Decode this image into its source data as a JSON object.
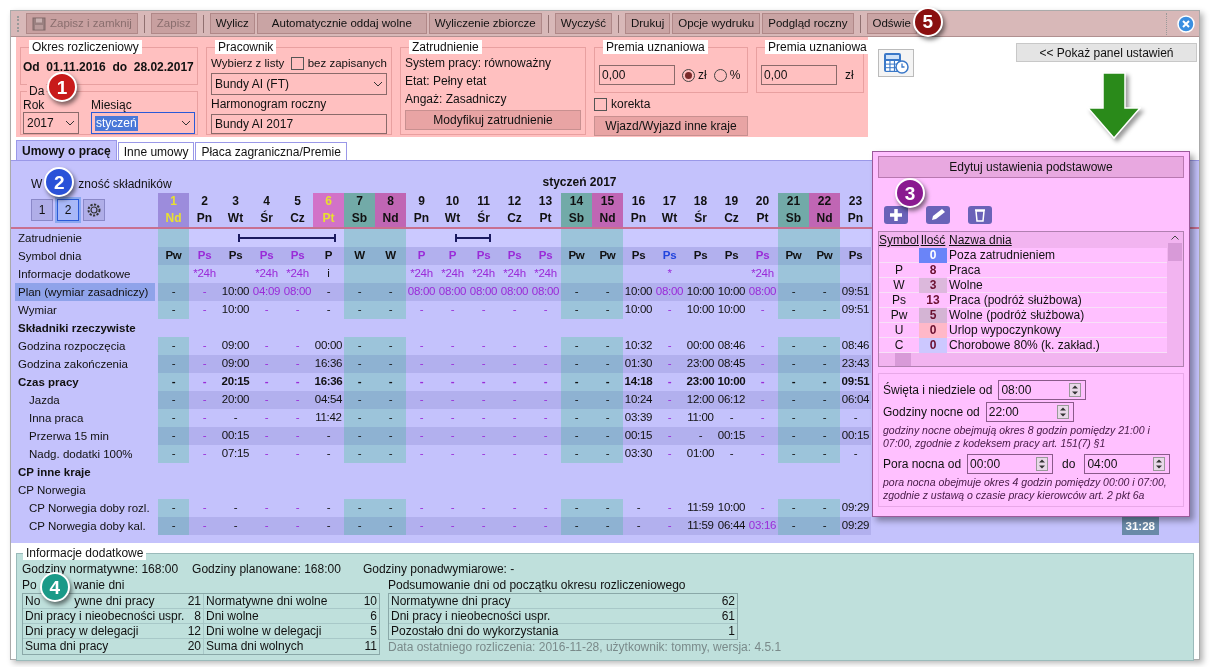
{
  "toolbar": {
    "buttons": [
      {
        "label": "Zapisz i zamknij",
        "disabled": true
      },
      {
        "label": "Zapisz",
        "disabled": true
      },
      {
        "label": "Wylicz",
        "disabled": false
      },
      {
        "label": "Automatycznie oddaj wolne",
        "disabled": false
      },
      {
        "label": "Wyliczenie zbiorcze",
        "disabled": false
      },
      {
        "label": "Wyczyść",
        "disabled": false
      },
      {
        "label": "Drukuj",
        "disabled": false
      },
      {
        "label": "Opcje wydruku",
        "disabled": false
      },
      {
        "label": "Podgląd roczny",
        "disabled": false
      },
      {
        "label": "Odświe",
        "disabled": false
      }
    ]
  },
  "period": {
    "title": "Okres rozliczeniowy",
    "range": "Od  01.11.2016  do  28.02.2017",
    "data_legend": "Da",
    "year_label": "Rok",
    "year": "2017",
    "month_label": "Miesiąc",
    "month": "styczeń"
  },
  "employee": {
    "title": "Pracownik",
    "pick_label": "Wybierz z listy",
    "unsaved": {
      "label": "bez zapisanych",
      "checked": false
    },
    "value": "Bundy AI (FT)",
    "schedule_label": "Harmonogram roczny",
    "schedule": "Bundy AI 2017"
  },
  "employment": {
    "title": "Zatrudnienie",
    "lines": [
      "System pracy: równoważny",
      "Etat: Pełny etat",
      "Angaż: Zasadniczy"
    ],
    "button": "Modyfikuj zatrudnienie"
  },
  "bonus": {
    "title": "Premia uznaniowa",
    "value": "0,00",
    "units": [
      {
        "label": "zł",
        "selected": true
      },
      {
        "label": "%",
        "selected": false
      }
    ],
    "correction": {
      "label": "korekta",
      "checked": false
    },
    "button": "Wjazd/Wyjazd inne kraje"
  },
  "bonus2": {
    "title": "Premia uznaniowa",
    "value": "0,00",
    "unit": "zł"
  },
  "show_panel_button": "<< Pokaż panel ustawień",
  "tabs": [
    {
      "label": "Umowy o pracę",
      "selected": true
    },
    {
      "label": "Inne umowy",
      "selected": false
    },
    {
      "label": "Płaca zagraniczna/Premie",
      "selected": false
    }
  ],
  "grid": {
    "visibility_label_parts": [
      "W",
      "zność składników"
    ],
    "visibility_buttons": [
      {
        "label": "1",
        "selected": false
      },
      {
        "label": "2",
        "selected": true
      }
    ],
    "month_title": "styczeń 2017",
    "days": [
      {
        "day": "1",
        "dow": "Nd",
        "kind": "holiday_sunday",
        "planned": false,
        "trip": false
      },
      {
        "day": "2",
        "dow": "Pn",
        "kind": "workday",
        "planned": true,
        "trip": false,
        "info": "*24h"
      },
      {
        "day": "3",
        "dow": "Wt",
        "kind": "workday",
        "planned": false,
        "trip": true
      },
      {
        "day": "4",
        "dow": "Śr",
        "kind": "workday",
        "planned": true,
        "trip": true,
        "info": "*24h"
      },
      {
        "day": "5",
        "dow": "Cz",
        "kind": "workday",
        "planned": true,
        "trip": true,
        "info": "*24h"
      },
      {
        "day": "6",
        "dow": "Pt",
        "kind": "holiday",
        "planned": false,
        "trip": true,
        "info": "i"
      },
      {
        "day": "7",
        "dow": "Sb",
        "kind": "saturday",
        "planned": false,
        "trip": false
      },
      {
        "day": "8",
        "dow": "Nd",
        "kind": "sunday",
        "planned": false,
        "trip": false
      },
      {
        "day": "9",
        "dow": "Pn",
        "kind": "workday",
        "planned": true,
        "trip": false,
        "info": "*24h"
      },
      {
        "day": "10",
        "dow": "Wt",
        "kind": "workday",
        "planned": true,
        "trip": true,
        "info": "*24h"
      },
      {
        "day": "11",
        "dow": "Śr",
        "kind": "workday",
        "planned": true,
        "trip": true,
        "info": "*24h"
      },
      {
        "day": "12",
        "dow": "Cz",
        "kind": "workday",
        "planned": true,
        "trip": false,
        "info": "*24h"
      },
      {
        "day": "13",
        "dow": "Pt",
        "kind": "workday",
        "planned": true,
        "trip": false,
        "info": "*24h"
      },
      {
        "day": "14",
        "dow": "Sb",
        "kind": "saturday",
        "planned": false,
        "trip": false
      },
      {
        "day": "15",
        "dow": "Nd",
        "kind": "sunday",
        "planned": false,
        "trip": false
      },
      {
        "day": "16",
        "dow": "Pn",
        "kind": "workday",
        "planned": false,
        "trip": false
      },
      {
        "day": "17",
        "dow": "Wt",
        "kind": "workday",
        "planned": true,
        "trip": false,
        "info": "*"
      },
      {
        "day": "18",
        "dow": "Śr",
        "kind": "workday",
        "planned": false,
        "trip": false
      },
      {
        "day": "19",
        "dow": "Cz",
        "kind": "workday",
        "planned": false,
        "trip": false
      },
      {
        "day": "20",
        "dow": "Pt",
        "kind": "workday",
        "planned": true,
        "trip": false,
        "info": "*24h"
      },
      {
        "day": "21",
        "dow": "Sb",
        "kind": "saturday",
        "planned": false,
        "trip": false
      },
      {
        "day": "22",
        "dow": "Nd",
        "kind": "sunday",
        "planned": false,
        "trip": false
      },
      {
        "day": "23",
        "dow": "Pn",
        "kind": "workday",
        "planned": false,
        "trip": false
      }
    ],
    "rows": [
      {
        "label": "Zatrudnienie",
        "kind": "trips",
        "selected": false
      },
      {
        "label": "Symbol dnia",
        "kind": "symbol",
        "selected": false,
        "values": [
          {
            "text": "Pw",
            "color": "#111111"
          },
          {
            "text": "Ps",
            "color": "#9a2bd8"
          },
          {
            "text": "Ps",
            "color": "#111111"
          },
          {
            "text": "Ps",
            "color": "#9a2bd8"
          },
          {
            "text": "Ps",
            "color": "#9a2bd8"
          },
          {
            "text": "P",
            "color": "#111111"
          },
          {
            "text": "W",
            "color": "#111111"
          },
          {
            "text": "W",
            "color": "#111111"
          },
          {
            "text": "P",
            "color": "#9a2bd8"
          },
          {
            "text": "P",
            "color": "#9a2bd8"
          },
          {
            "text": "Ps",
            "color": "#9a2bd8"
          },
          {
            "text": "Ps",
            "color": "#9a2bd8"
          },
          {
            "text": "Ps",
            "color": "#9a2bd8"
          },
          {
            "text": "Pw",
            "color": "#111111"
          },
          {
            "text": "Pw",
            "color": "#111111"
          },
          {
            "text": "Ps",
            "color": "#111111"
          },
          {
            "text": "Ps",
            "color": "#2244dd"
          },
          {
            "text": "Ps",
            "color": "#111111"
          },
          {
            "text": "Ps",
            "color": "#111111"
          },
          {
            "text": "Ps",
            "color": "#9a2bd8"
          },
          {
            "text": "Pw",
            "color": "#111111"
          },
          {
            "text": "Pw",
            "color": "#111111"
          },
          {
            "text": "Ps",
            "color": "#111111"
          }
        ]
      },
      {
        "label": "Informacje dodatkowe",
        "kind": "info",
        "selected": false
      },
      {
        "label": "Plan (wymiar zasadniczy)",
        "kind": "values",
        "selected": true,
        "values": [
          "-",
          "-",
          "10:00",
          "04:09",
          "08:00",
          "-",
          "-",
          "-",
          "08:00",
          "08:00",
          "08:00",
          "08:00",
          "08:00",
          "-",
          "-",
          "10:00",
          "08:00",
          "10:00",
          "10:00",
          "08:00",
          "-",
          "-",
          "09:51"
        ]
      },
      {
        "label": "Wymiar",
        "kind": "values",
        "selected": false,
        "values": [
          "-",
          "-",
          "10:00",
          "-",
          "-",
          "-",
          "-",
          "-",
          "-",
          "-",
          "-",
          "-",
          "-",
          "-",
          "-",
          "10:00",
          "-",
          "10:00",
          "10:00",
          "-",
          "-",
          "-",
          "09:51"
        ]
      },
      {
        "label": "Składniki rzeczywiste",
        "kind": "section",
        "bold": true,
        "selected": false
      },
      {
        "label": "Godzina rozpoczęcia",
        "kind": "values",
        "selected": false,
        "values": [
          "-",
          "-",
          "09:00",
          "-",
          "-",
          "00:00",
          "-",
          "-",
          "-",
          "-",
          "-",
          "-",
          "-",
          "-",
          "-",
          "10:32",
          "-",
          "00:00",
          "08:46",
          "-",
          "-",
          "-",
          "08:46"
        ]
      },
      {
        "label": "Godzina zakończenia",
        "kind": "values",
        "selected": false,
        "values": [
          "-",
          "-",
          "09:00",
          "-",
          "-",
          "16:36",
          "-",
          "-",
          "-",
          "-",
          "-",
          "-",
          "-",
          "-",
          "-",
          "01:30",
          "-",
          "23:00",
          "08:45",
          "-",
          "-",
          "-",
          "23:43"
        ]
      },
      {
        "label": "Czas pracy",
        "kind": "values",
        "bold": true,
        "selected": false,
        "values": [
          "-",
          "-",
          "20:15",
          "-",
          "-",
          "16:36",
          "-",
          "-",
          "-",
          "-",
          "-",
          "-",
          "-",
          "-",
          "-",
          "14:18",
          "-",
          "23:00",
          "10:00",
          "-",
          "-",
          "-",
          "09:51"
        ],
        "children": [
          {
            "label": "Jazda",
            "kind": "values",
            "selected": false,
            "values": [
              "-",
              "-",
              "20:00",
              "-",
              "-",
              "04:54",
              "-",
              "-",
              "-",
              "-",
              "-",
              "-",
              "-",
              "-",
              "-",
              "10:24",
              "-",
              "12:00",
              "06:12",
              "-",
              "-",
              "-",
              "06:04"
            ]
          },
          {
            "label": "Inna praca",
            "kind": "values",
            "selected": false,
            "values": [
              "-",
              "-",
              "-",
              "-",
              "-",
              "11:42",
              "-",
              "-",
              "-",
              "-",
              "-",
              "-",
              "-",
              "-",
              "-",
              "03:39",
              "-",
              "11:00",
              "-",
              "-",
              "-",
              "-",
              "-"
            ]
          },
          {
            "label": "Przerwa 15 min",
            "kind": "values",
            "selected": false,
            "values": [
              "-",
              "-",
              "00:15",
              "-",
              "-",
              "-",
              "-",
              "-",
              "-",
              "-",
              "-",
              "-",
              "-",
              "-",
              "-",
              "00:15",
              "-",
              "-",
              "00:15",
              "-",
              "-",
              "-",
              "00:15"
            ]
          },
          {
            "label": "Nadg. dodatki 100%",
            "kind": "values",
            "selected": false,
            "values": [
              "-",
              "-",
              "07:15",
              "-",
              "-",
              "-",
              "-",
              "-",
              "-",
              "-",
              "-",
              "-",
              "-",
              "-",
              "-",
              "03:30",
              "-",
              "01:00",
              "-",
              "-",
              "-",
              "-",
              "-"
            ]
          }
        ]
      },
      {
        "label": "CP inne kraje",
        "kind": "section",
        "bold": true,
        "selected": false
      },
      {
        "label": "CP Norwegia",
        "kind": "section",
        "bold": false,
        "selected": false,
        "children": [
          {
            "label": "CP Norwegia doby rozl.",
            "kind": "values",
            "selected": false,
            "values": [
              "-",
              "-",
              "-",
              "-",
              "-",
              "-",
              "-",
              "-",
              "-",
              "-",
              "-",
              "-",
              "-",
              "-",
              "-",
              "-",
              "-",
              "11:59",
              "10:00",
              "-",
              "-",
              "-",
              "09:29"
            ]
          },
          {
            "label": "CP Norwegia doby kal.",
            "kind": "values",
            "selected": false,
            "total": "31:28",
            "values": [
              "-",
              "-",
              "-",
              "-",
              "-",
              "-",
              "-",
              "-",
              "-",
              "-",
              "-",
              "-",
              "-",
              "-",
              "-",
              "-",
              "-",
              "11:59",
              "06:44",
              "03:16",
              "-",
              "-",
              "09:29"
            ]
          }
        ]
      }
    ]
  },
  "settings_popup": {
    "title_button": "Edytuj ustawienia podstawowe",
    "columns": [
      "Symbol",
      "Ilość",
      "Nazwa dnia"
    ],
    "rows": [
      {
        "count": "0",
        "name": "Poza zatrudnieniem",
        "color": "#6a84f8"
      },
      {
        "symbol": "P",
        "count": "8",
        "name": "Praca",
        "color": "#ffc0ff"
      },
      {
        "symbol": "W",
        "count": "3",
        "name": "Wolne",
        "color": "#dcb8dc"
      },
      {
        "symbol": "Ps",
        "count": "13",
        "name": "Praca (podróż służbowa)",
        "color": "#ffc0ff"
      },
      {
        "symbol": "Pw",
        "count": "5",
        "name": "Wolne (podróż służbowa)",
        "color": "#d4b4d4"
      },
      {
        "symbol": "U",
        "count": "0",
        "name": "Urlop wypoczynkowy",
        "color": "#ffb8c8"
      },
      {
        "symbol": "C",
        "count": "0",
        "name": "Chorobowe 80% (k. zakład.)",
        "color": "#ccc8ff"
      }
    ],
    "holidays_label": "Święta i niedziele od",
    "holidays_value": "08:00",
    "night_label": "Godziny nocne od",
    "night_value": "22:00",
    "night_note": "godziny nocne obejmują okres 8 godzin pomiędzy 21:00 i 07:00, zgodnie z kodeksem pracy art. 151(7) §1",
    "night_period_label": "Pora nocna od",
    "night_from": "00:00",
    "night_to_label": "do",
    "night_to": "04:00",
    "night_period_note": "pora nocna obejmuje okres 4 godzin pomiędzy 00:00 i 07:00, zgodnie z ustawą o czasie pracy kierowców art. 2 pkt 6a"
  },
  "summary": {
    "legend": "Informacje dodatkowe",
    "hours": [
      "Godziny normatywne: 168:00",
      "Godziny planowane: 168:00",
      "Godziny ponadwymiarowe: -"
    ],
    "days_title_parts": [
      "Po",
      "wanie dni"
    ],
    "days_rows": [
      [
        {
          "label_parts": [
            "No",
            "ywne dni pracy"
          ],
          "value": "21"
        },
        {
          "label": "Normatywne dni wolne",
          "value": "10"
        }
      ],
      [
        {
          "label": "Dni pracy i nieobecności uspr.",
          "value": "8"
        },
        {
          "label": "Dni wolne",
          "value": "6"
        }
      ],
      [
        {
          "label": "Dni pracy w delegacji",
          "value": "12"
        },
        {
          "label": "Dni wolne w delegacji",
          "value": "5"
        }
      ],
      [
        {
          "label": "Suma dni pracy",
          "value": "20"
        },
        {
          "label": "Suma dni wolnych",
          "value": "11"
        }
      ]
    ],
    "period_title": "Podsumowanie dni od początku okresu rozliczeniowego",
    "period_rows": [
      {
        "label": "Normatywne dni pracy",
        "value": "62"
      },
      {
        "label": "Dni pracy i nieobecności uspr.",
        "value": "61"
      },
      {
        "label": "Pozostało dni do wykorzystania",
        "value": "1"
      }
    ],
    "footer": "Data ostatniego rozliczenia: 2016-11-28, użytkownik: tommy, wersja: 4.5.1"
  },
  "callouts": [
    {
      "label": "5",
      "color": "#8a1010"
    },
    {
      "label": "1",
      "color": "#c81a1a"
    },
    {
      "label": "2",
      "color": "#2a52d8"
    },
    {
      "label": "3",
      "color": "#8a1a90"
    },
    {
      "label": "4",
      "color": "#1a9a88"
    }
  ]
}
